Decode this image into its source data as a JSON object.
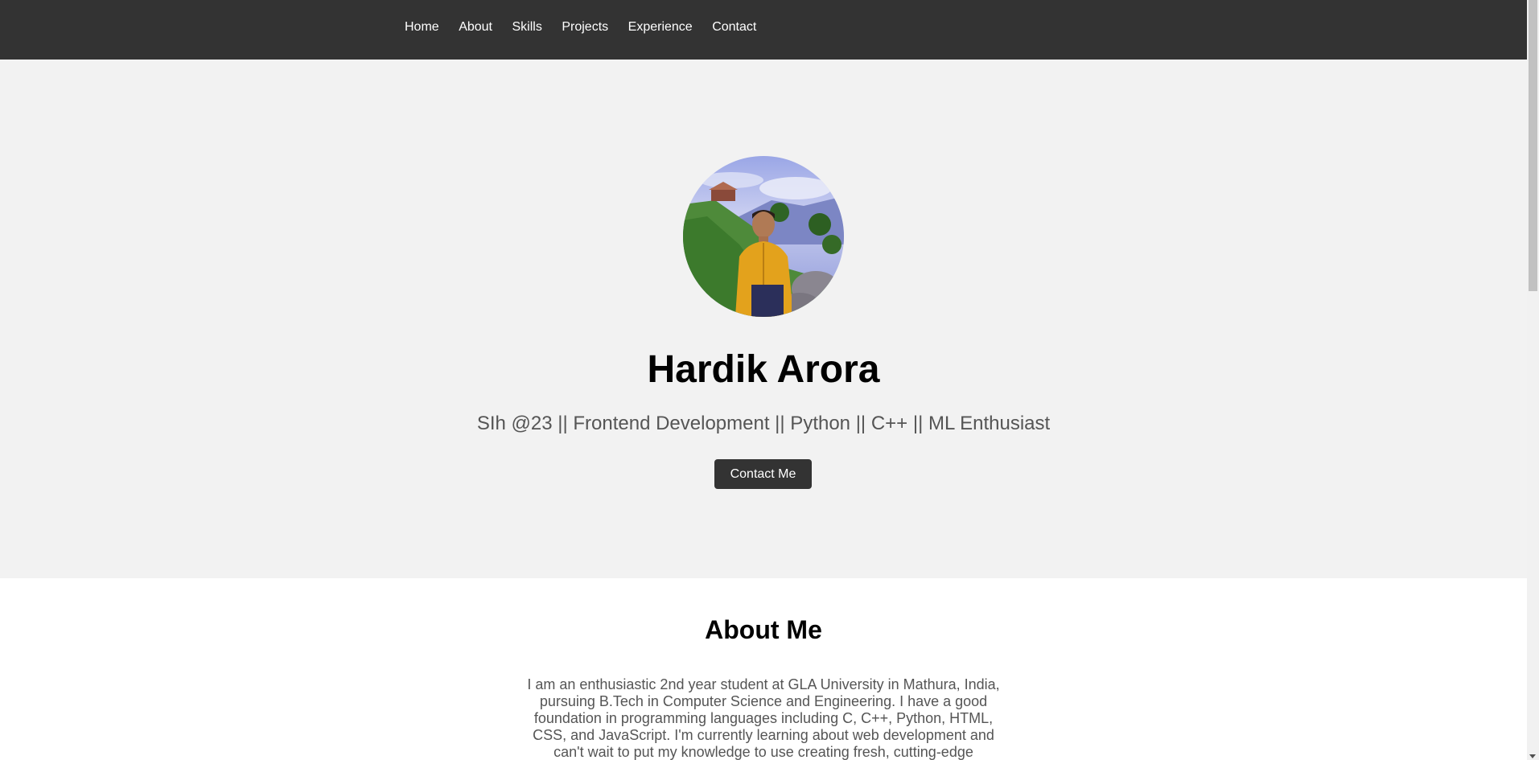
{
  "nav": {
    "items": [
      {
        "label": "Home"
      },
      {
        "label": "About"
      },
      {
        "label": "Skills"
      },
      {
        "label": "Projects"
      },
      {
        "label": "Experience"
      },
      {
        "label": "Contact"
      }
    ]
  },
  "hero": {
    "name": "Hardik Arora",
    "tagline": "SIh @23 || Frontend Development || Python || C++ || ML Enthusiast",
    "contact_button": "Contact Me",
    "avatar_icon": "profile-photo"
  },
  "about": {
    "title": "About Me",
    "text": "I am an enthusiastic 2nd year student at GLA University in Mathura, India, pursuing B.Tech in Computer Science and Engineering. I have a good foundation in programming languages including C, C++, Python, HTML, CSS, and JavaScript. I'm currently learning about web development and can't wait to put my knowledge to use creating fresh, cutting-edge"
  },
  "colors": {
    "nav_bg": "#333333",
    "hero_bg": "#f2f2f2",
    "button_bg": "#333333",
    "text_muted": "#555555"
  }
}
